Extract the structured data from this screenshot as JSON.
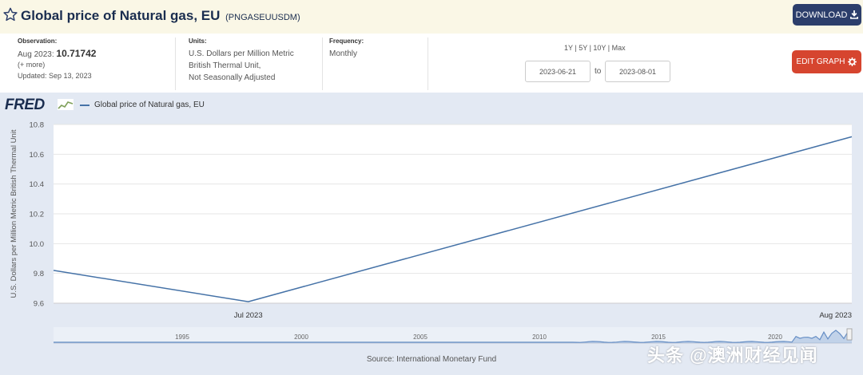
{
  "header": {
    "title": "Global price of Natural gas, EU",
    "series_id": "(PNGASEUUSDM)",
    "download_label": "DOWNLOAD",
    "download_icon": "download-icon",
    "star_icon": "star-icon"
  },
  "meta": {
    "observation_label": "Observation:",
    "observation_date": "Aug 2023:",
    "observation_value": "10.71742",
    "more_label": "(+ more)",
    "updated": "Updated: Sep 13, 2023",
    "units_label": "Units:",
    "units_line1": "U.S. Dollars per Million Metric",
    "units_line2": "British Thermal Unit,",
    "units_line3": "Not Seasonally Adjusted",
    "frequency_label": "Frequency:",
    "frequency": "Monthly"
  },
  "range": {
    "links": [
      "1Y",
      "5Y",
      "10Y",
      "Max"
    ],
    "start": "2023-06-21",
    "end": "2023-08-01",
    "to_label": "to"
  },
  "edit_label": "EDIT GRAPH",
  "edit_icon": "gear-icon",
  "logo": "FRED",
  "source": "Source: International Monetary Fund",
  "watermark": "头条 @澳洲财经见闻",
  "accent_color": "#4572a7",
  "chart_data": {
    "type": "line",
    "title": "",
    "legend": [
      "Global price of Natural gas, EU"
    ],
    "legend_placement": "top-left",
    "ylabel": "U.S. Dollars per Million Metric British Thermal Unit",
    "ylim": [
      9.6,
      10.8
    ],
    "yticks": [
      9.6,
      9.8,
      10.0,
      10.2,
      10.4,
      10.6,
      10.8
    ],
    "ytick_labels": [
      "9.6",
      "9.8",
      "10.0",
      "10.2",
      "10.4",
      "10.6",
      "10.8"
    ],
    "xlim": [
      "2023-06-21",
      "2023-08-01"
    ],
    "xticks": [
      "2023-07-01",
      "2023-08-01"
    ],
    "xtick_labels": [
      "Jul 2023",
      "Aug 2023"
    ],
    "grid": true,
    "series": [
      {
        "name": "Global price of Natural gas, EU",
        "x": [
          "2023-06-21",
          "2023-07-01",
          "2023-08-01"
        ],
        "y": [
          9.82,
          9.61,
          10.71742
        ]
      }
    ],
    "navigator": {
      "tick_labels": [
        "1995",
        "2000",
        "2005",
        "2010",
        "2015",
        "2020"
      ]
    }
  }
}
